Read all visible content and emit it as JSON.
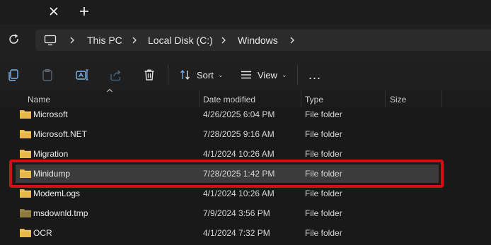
{
  "breadcrumb": {
    "items": [
      "This PC",
      "Local Disk (C:)",
      "Windows"
    ]
  },
  "toolbar": {
    "sort_label": "Sort",
    "view_label": "View",
    "more_label": "..."
  },
  "columns": {
    "name": "Name",
    "date": "Date modified",
    "type": "Type",
    "size": "Size"
  },
  "rows": [
    {
      "name": "Microsoft",
      "date": "4/26/2025 6:04 PM",
      "type": "File folder"
    },
    {
      "name": "Microsoft.NET",
      "date": "7/28/2025 9:16 AM",
      "type": "File folder"
    },
    {
      "name": "Migration",
      "date": "4/1/2024 10:26 AM",
      "type": "File folder"
    },
    {
      "name": "Minidump",
      "date": "7/28/2025 1:42 PM",
      "type": "File folder"
    },
    {
      "name": "ModemLogs",
      "date": "4/1/2024 10:26 AM",
      "type": "File folder"
    },
    {
      "name": "msdownld.tmp",
      "date": "7/9/2024 3:56 PM",
      "type": "File folder"
    },
    {
      "name": "OCR",
      "date": "4/1/2024 7:32 PM",
      "type": "File folder"
    }
  ],
  "colors": {
    "highlight": "#d40f13",
    "folder": "#e8b74a",
    "folder_dim": "#8c7a3e"
  }
}
